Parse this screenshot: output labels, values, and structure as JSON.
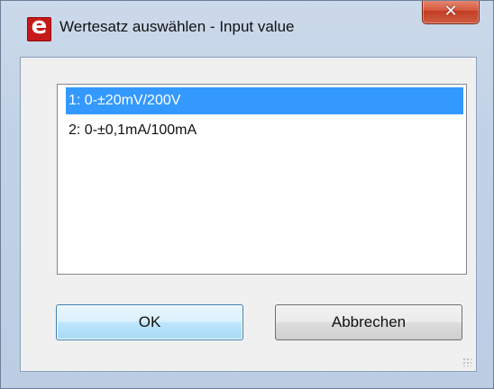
{
  "window": {
    "title": "Wertesatz auswählen - Input value",
    "app_icon_letter": "e",
    "close_glyph": "✕"
  },
  "list": {
    "items": [
      {
        "label": "1: 0-±20mV/200V",
        "selected": true
      },
      {
        "label": "2: 0-±0,1mA/100mA",
        "selected": false
      }
    ]
  },
  "buttons": {
    "ok_label": "OK",
    "cancel_label": "Abbrechen"
  },
  "colors": {
    "selection": "#3399ff",
    "close_button": "#c94a31",
    "app_icon": "#c61a1a",
    "default_button_border": "#3c7fb1"
  },
  "icons": {
    "app": "app-logo-icon",
    "close": "close-icon",
    "resize": "resize-grip-icon"
  }
}
